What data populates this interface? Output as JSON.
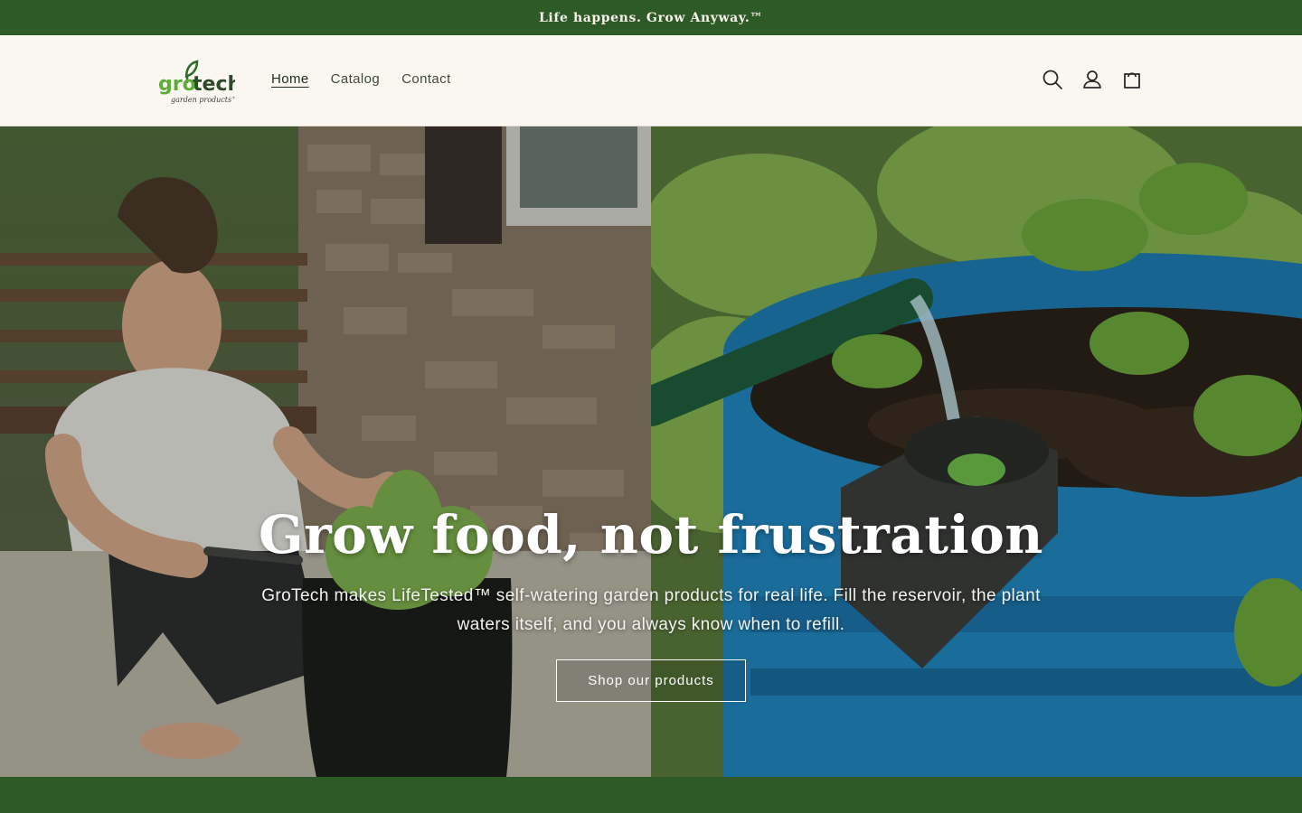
{
  "announcement": {
    "text": "Life happens. Grow Anyway.™"
  },
  "header": {
    "logo": {
      "name": "grotech",
      "tagline": "garden products"
    },
    "nav": [
      {
        "label": "Home",
        "active": true
      },
      {
        "label": "Catalog",
        "active": false
      },
      {
        "label": "Contact",
        "active": false
      }
    ],
    "icons": [
      "search-icon",
      "account-icon",
      "cart-icon"
    ]
  },
  "hero": {
    "title": "Grow food, not frustration",
    "subtitle": "GroTech makes LifeTested™ self-watering garden products for real life. Fill the reservoir, the plant waters itself, and you always know when to refill.",
    "button_label": "Shop our products"
  },
  "colors": {
    "brand_green": "#2d5a27",
    "header_bg": "#faf7f1",
    "logo_green": "#5cae3b"
  }
}
